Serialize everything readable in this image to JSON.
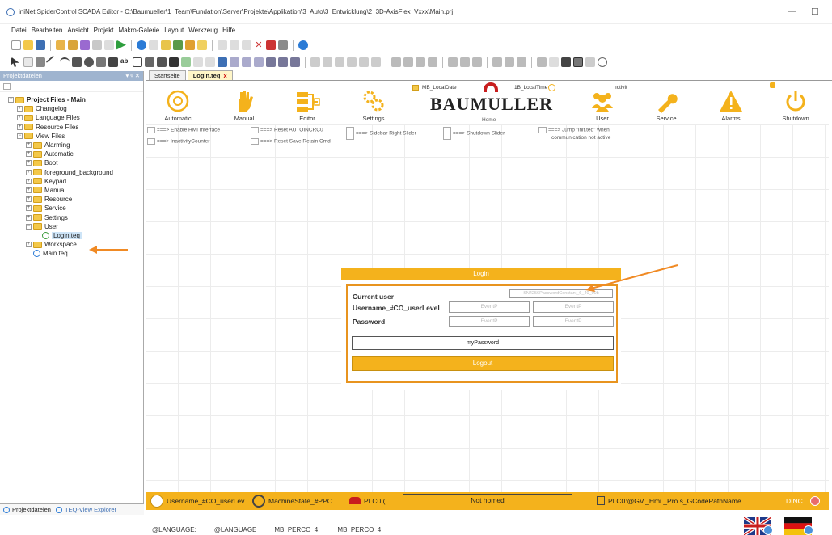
{
  "window": {
    "title": "iniNet SpiderControl SCADA Editor - C:\\Baumueller\\1_Team\\Fundation\\Server\\Projekte\\Applikation\\3_Auto\\3_Entwicklung\\2_3D-AxisFlex_Vxxx\\Main.prj",
    "minimize": "—",
    "maximize": "☐"
  },
  "menu": [
    "Datei",
    "Bearbeiten",
    "Ansicht",
    "Projekt",
    "Makro-Galerie",
    "Layout",
    "Werkzeug",
    "Hilfe"
  ],
  "left_panel": {
    "title": "Projektdateien",
    "pin": "▾ ᵠ ✕",
    "tree": [
      {
        "label": "Project Files - Main",
        "level": 0,
        "type": "folder",
        "bold": true,
        "expanded": true
      },
      {
        "label": "Changelog",
        "level": 1,
        "type": "folder"
      },
      {
        "label": "Language Files",
        "level": 1,
        "type": "folder"
      },
      {
        "label": "Resource Files",
        "level": 1,
        "type": "folder"
      },
      {
        "label": "View Files",
        "level": 1,
        "type": "folder",
        "expanded": true
      },
      {
        "label": "Alarming",
        "level": 2,
        "type": "folder"
      },
      {
        "label": "Automatic",
        "level": 2,
        "type": "folder"
      },
      {
        "label": "Boot",
        "level": 2,
        "type": "folder"
      },
      {
        "label": "foreground_background",
        "level": 2,
        "type": "folder"
      },
      {
        "label": "Keypad",
        "level": 2,
        "type": "folder"
      },
      {
        "label": "Manual",
        "level": 2,
        "type": "folder"
      },
      {
        "label": "Resource",
        "level": 2,
        "type": "folder"
      },
      {
        "label": "Service",
        "level": 2,
        "type": "folder"
      },
      {
        "label": "Settings",
        "level": 2,
        "type": "folder"
      },
      {
        "label": "User",
        "level": 2,
        "type": "folder",
        "expanded": true
      },
      {
        "label": "Login.teq",
        "level": 3,
        "type": "file-green",
        "selected": true
      },
      {
        "label": "Workspace",
        "level": 2,
        "type": "folder"
      },
      {
        "label": "Main.teq",
        "level": 2,
        "type": "file"
      }
    ],
    "bottom_tabs": [
      "Projektdateien",
      "TEQ-View Explorer"
    ]
  },
  "doc_tabs": [
    {
      "label": "Startseite",
      "active": false
    },
    {
      "label": "Login.teq",
      "active": true,
      "close": "x"
    }
  ],
  "header": {
    "nav": [
      {
        "label": "Automatic",
        "icon": "automatic-icon"
      },
      {
        "label": "Manual",
        "icon": "hand-icon"
      },
      {
        "label": "Editor",
        "icon": "editor-icon"
      },
      {
        "label": "Settings",
        "icon": "gears-icon"
      },
      {
        "label": "User",
        "icon": "users-icon"
      },
      {
        "label": "Service",
        "icon": "wrench-icon"
      },
      {
        "label": "Alarms",
        "icon": "warning-icon"
      },
      {
        "label": "Shutdown",
        "icon": "power-icon"
      }
    ],
    "logo_text": "BAUMULLER",
    "home_label": "Home",
    "local_date": "MB_LocalDate",
    "local_time": "1B_LocalTime",
    "activity": "ıctivit"
  },
  "annotations": [
    "===> Enable HMI Interface",
    "===> Reset AUTOINCRC0",
    "===> Sidebar Right Slider",
    "===> Shutdown Slider",
    "===> Jump \"init.teq\" when",
    "communication not active",
    "===> InactivityCounter",
    "===> Reset Save Retain Cmd"
  ],
  "login": {
    "title": "Login",
    "current_user_label": "Current user",
    "current_user_value": "SN4256PasswordConstant_6_40_00b",
    "username_label": "Username_#CO_userLevel",
    "password_label": "Password",
    "event_placeholder": "EventP",
    "password_value": "myPassword",
    "logout_label": "Logout"
  },
  "bottom_info": {
    "language_label": "@LANGUAGE:",
    "language_value": "@LANGUAGE",
    "perco_label": "MB_PERCO_4:",
    "perco_value": "MB_PERCO_4"
  },
  "statusbar": {
    "user": "Username_#CO_userLev",
    "machine_state": "MachineState_#PPO",
    "plc": "PLC0:(",
    "homed": "Not homed",
    "gcode": "PLC0:@GV._Hmi._Pro.s_GCodePathName",
    "dinc": "DINC"
  },
  "colors": {
    "accent": "#f4b21c",
    "brand_red": "#c81e1e",
    "panel_header": "#9fb4cf"
  }
}
